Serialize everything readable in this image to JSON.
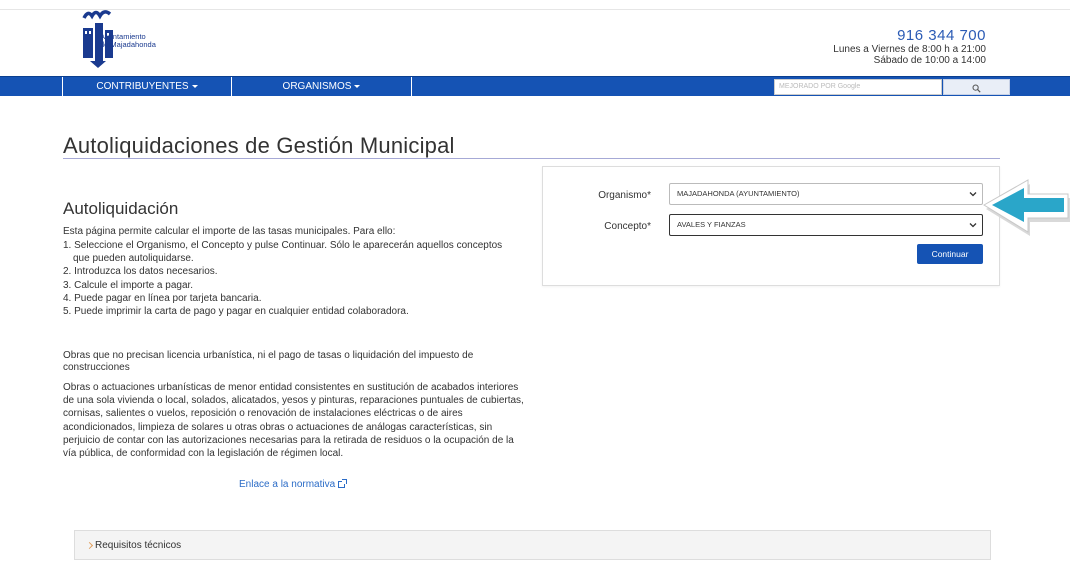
{
  "header": {
    "logo_line1": "Ayuntamiento",
    "logo_line2": "de Majadahonda",
    "phone": "916 344 700",
    "hours_weekdays": "Lunes a Viernes de 8:00 h a 21:00",
    "hours_saturday": "Sábado de 10:00 a 14:00"
  },
  "nav": {
    "items": [
      {
        "label": "CONTRIBUYENTES"
      },
      {
        "label": "ORGANISMOS"
      }
    ],
    "search_placeholder": "MEJORADO POR Google",
    "search_icon": "search-icon"
  },
  "page": {
    "title": "Autoliquidaciones de Gestión Municipal",
    "section_title": "Autoliquidación",
    "intro": "Esta página permite calcular el importe de las tasas municipales. Para ello:",
    "steps": [
      {
        "line1": "1. Seleccione el Organismo, el Concepto y pulse Continuar. Sólo le aparecerán aquellos conceptos",
        "line2": "que pueden autoliquidarse."
      },
      {
        "line1": "2. Introduzca los datos necesarios."
      },
      {
        "line1": "3. Calcule el importe a pagar."
      },
      {
        "line1": "4. Puede pagar en línea por tarjeta bancaria."
      },
      {
        "line1": "5. Puede imprimir la carta de pago y pagar en cualquier entidad colaboradora."
      }
    ],
    "obras_title": "Obras que no precisan licencia urbanística, ni el pago de tasas o liquidación del impuesto de construcciones",
    "obras_text": "Obras o actuaciones urbanísticas de menor entidad consistentes en sustitución de acabados interiores de una sola vivienda o local, solados, alicatados, yesos y pinturas, reparaciones puntuales de cubiertas, cornisas, salientes o vuelos, reposición o renovación de instalaciones eléctricas o de aires acondicionados, limpieza de solares u otras obras o actuaciones de análogas características, sin perjuicio de contar con las autorizaciones necesarias para la retirada de residuos o la ocupación de la vía pública, de conformidad con la legislación de régimen local.",
    "normativa_link": "Enlace a la normativa"
  },
  "form": {
    "organismo_label": "Organismo*",
    "organismo_value": "MAJADAHONDA (AYUNTAMIENTO)",
    "concepto_label": "Concepto*",
    "concepto_value": "AVALES Y FIANZAS",
    "continue_label": "Continuar"
  },
  "requirements": {
    "label": "Requisitos técnicos"
  },
  "colors": {
    "nav_blue": "#1553b4",
    "phone_blue": "#2b5bb5",
    "pointer_teal": "#2aa6c9"
  }
}
